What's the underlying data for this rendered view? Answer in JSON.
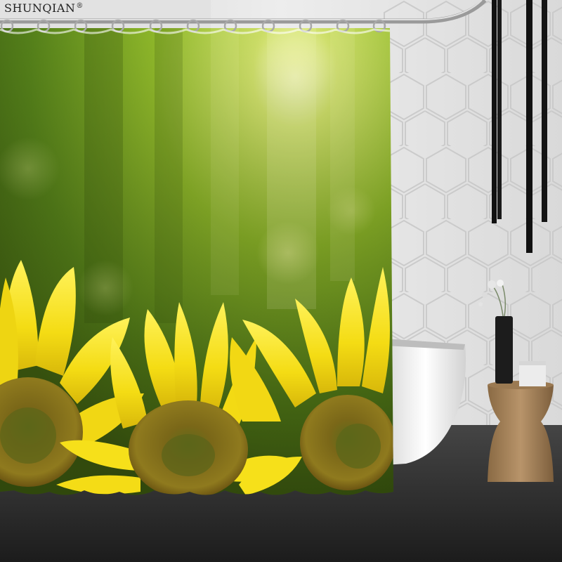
{
  "watermark": {
    "brand": "SHUNQIAN",
    "mark": "®"
  },
  "scene": {
    "subject": "sunflower-shower-curtain",
    "colors": {
      "wall": "#e9e9e9",
      "floor": "#2d2d2d",
      "curtain_green": "#7fae1e",
      "sunflower_yellow": "#f6e21a",
      "sunflower_center": "#6e5a16",
      "stool_wood": "#a8835a"
    }
  }
}
